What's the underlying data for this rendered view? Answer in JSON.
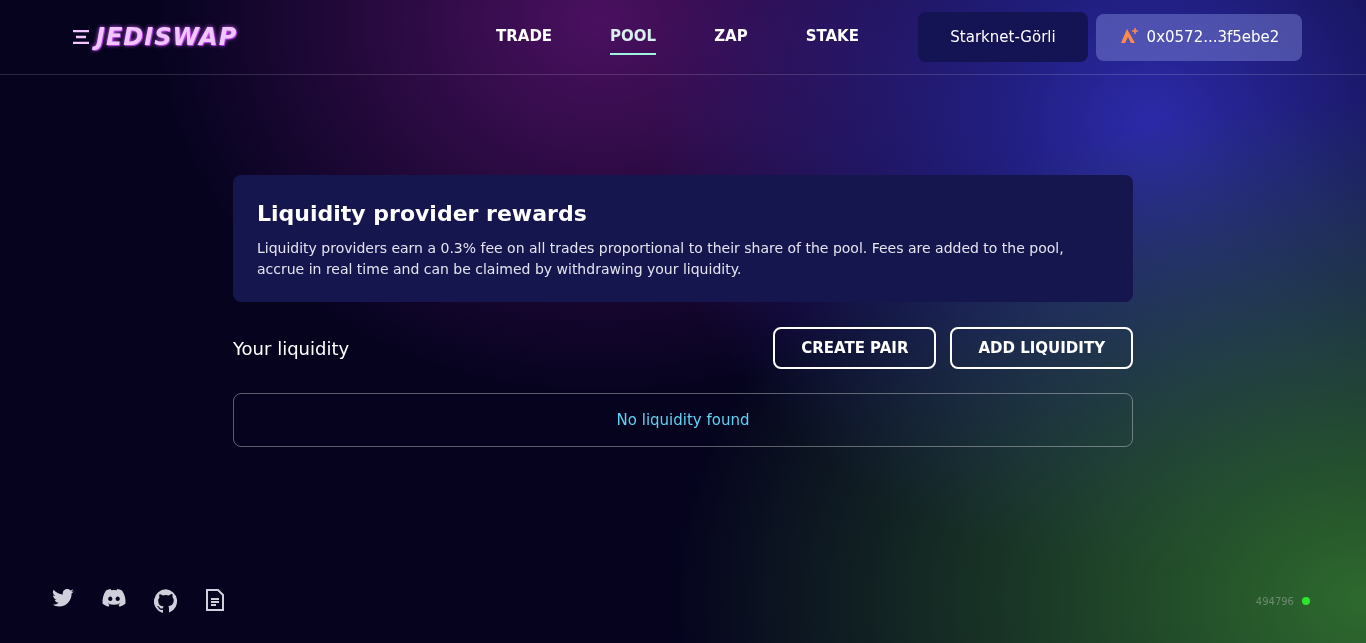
{
  "logo": {
    "text": "JEDISWAP"
  },
  "nav": [
    {
      "label": "TRADE",
      "selected": false
    },
    {
      "label": "POOL",
      "selected": true
    },
    {
      "label": "ZAP",
      "selected": false
    },
    {
      "label": "STAKE",
      "selected": false
    }
  ],
  "network_button": "Starknet-Görli",
  "wallet_button": "0x0572...3f5ebe2",
  "info_card": {
    "title": "Liquidity provider rewards",
    "text": "Liquidity providers earn a 0.3% fee on all trades proportional to their share of the pool. Fees are added to the pool, accrue in real time and can be claimed by withdrawing your liquidity."
  },
  "liquidity": {
    "heading": "Your liquidity",
    "buttons": [
      "CREATE PAIR",
      "ADD LIQUIDITY"
    ],
    "empty_message": "No liquidity found"
  },
  "footer": {
    "block_number": "494796"
  }
}
